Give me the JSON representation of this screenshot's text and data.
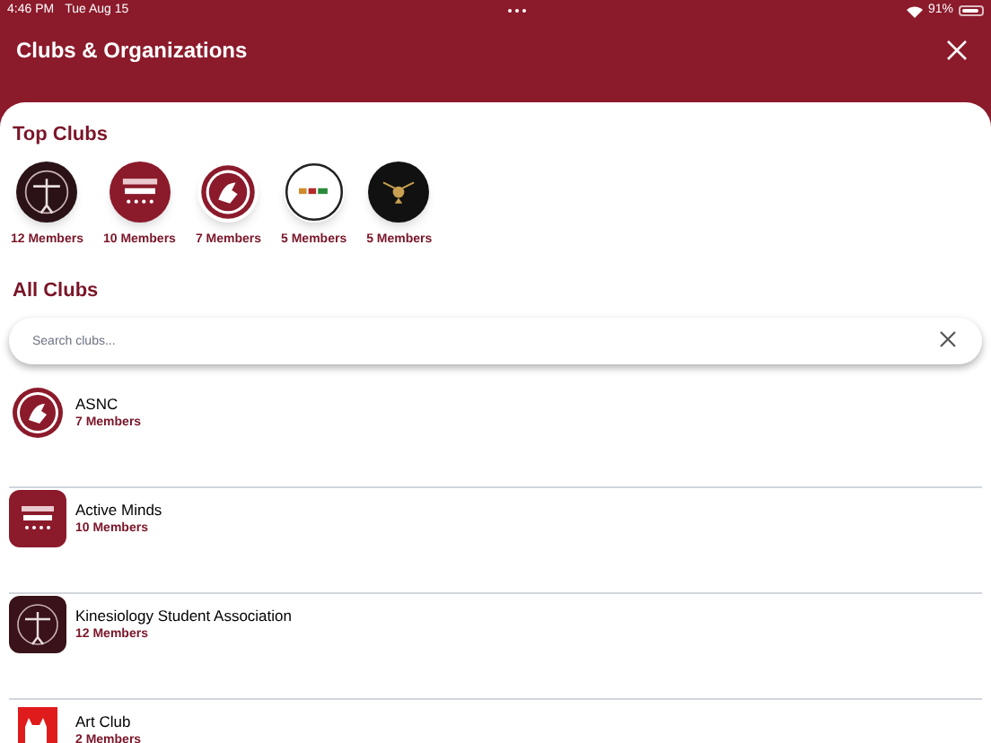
{
  "status_bar": {
    "time": "4:46 PM",
    "date": "Tue Aug 15",
    "battery": "91%"
  },
  "header": {
    "title": "Clubs & Organizations"
  },
  "top_clubs": {
    "title": "Top Clubs",
    "items": [
      {
        "kind": "figure",
        "members": "12 Members"
      },
      {
        "kind": "minds",
        "members": "10 Members"
      },
      {
        "kind": "seal",
        "members": "7 Members"
      },
      {
        "kind": "ring",
        "members": "5 Members"
      },
      {
        "kind": "dark",
        "members": "5 Members"
      }
    ]
  },
  "all_clubs": {
    "title": "All Clubs",
    "search": {
      "placeholder": "Search clubs..."
    },
    "items": [
      {
        "kind": "seal",
        "name": "ASNC",
        "members": "7 Members"
      },
      {
        "kind": "minds",
        "name": "Active Minds",
        "members": "10 Members"
      },
      {
        "kind": "figure",
        "name": "Kinesiology Student Association",
        "members": "12 Members"
      },
      {
        "kind": "art",
        "name": "Art Club",
        "members": "2 Members"
      }
    ]
  }
}
